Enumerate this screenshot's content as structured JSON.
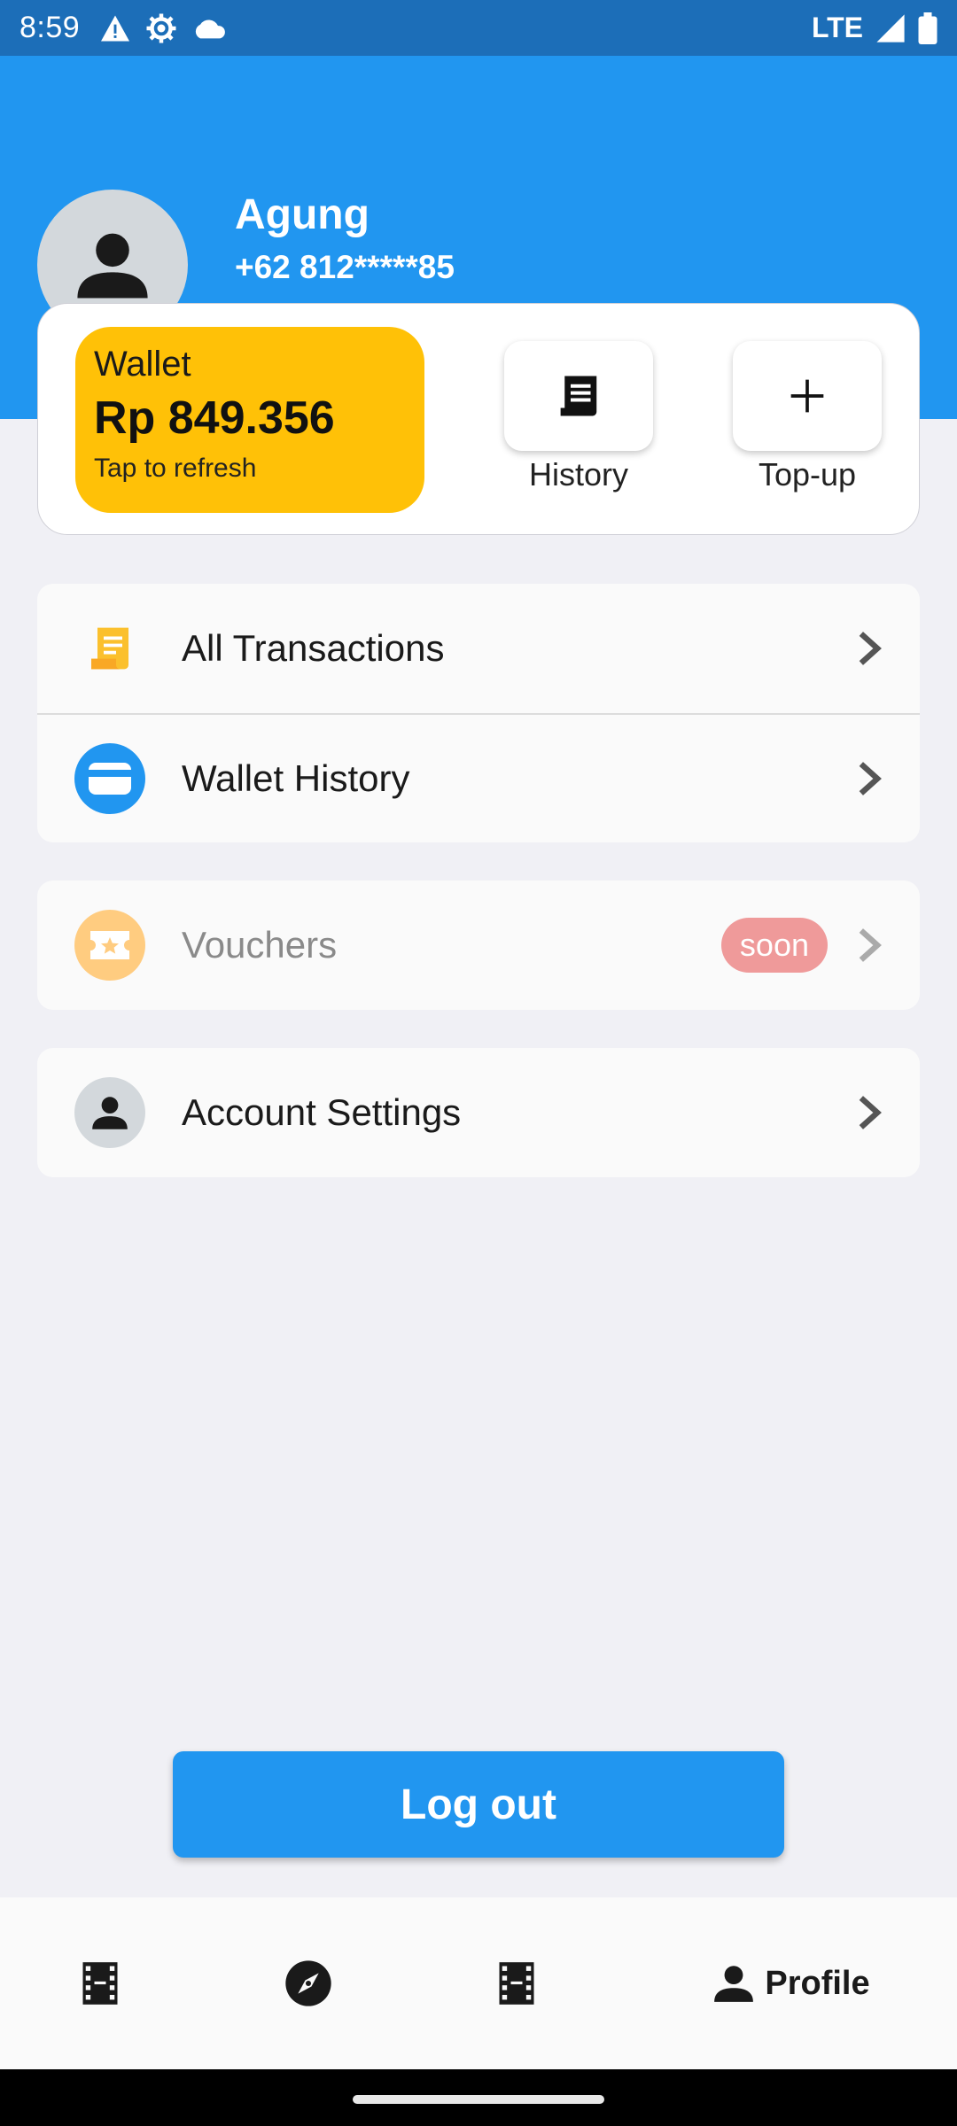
{
  "status_bar": {
    "time": "8:59",
    "network": "LTE",
    "icons": [
      "warning-icon",
      "settings-icon",
      "cloud-icon",
      "signal-icon",
      "battery-icon"
    ]
  },
  "profile": {
    "name": "Agung",
    "phone": "+62 812*****85",
    "avatar_icon": "person-icon"
  },
  "wallet": {
    "label": "Wallet",
    "balance": "Rp 849.356",
    "hint": "Tap to refresh",
    "color": "#FFC107"
  },
  "quick_actions": [
    {
      "label": "History",
      "icon": "receipt-icon"
    },
    {
      "label": "Top-up",
      "icon": "plus-icon"
    }
  ],
  "menu_group_1": [
    {
      "label": "All Transactions",
      "icon": "receipt-icon"
    },
    {
      "label": "Wallet History",
      "icon": "wallet-icon"
    }
  ],
  "menu_group_2": [
    {
      "label": "Vouchers",
      "icon": "ticket-icon",
      "badge": "soon"
    }
  ],
  "menu_group_3": [
    {
      "label": "Account Settings",
      "icon": "person-icon"
    }
  ],
  "logout_label": "Log out",
  "bottom_nav": [
    {
      "label": "",
      "icon": "film-icon"
    },
    {
      "label": "",
      "icon": "compass-icon"
    },
    {
      "label": "",
      "icon": "film-icon"
    },
    {
      "label": "Profile",
      "icon": "person-icon",
      "active": true
    }
  ],
  "colors": {
    "primary": "#2196F0",
    "status_bar": "#1C6EB8",
    "wallet": "#FFC107",
    "badge": "#EF9A9A"
  }
}
